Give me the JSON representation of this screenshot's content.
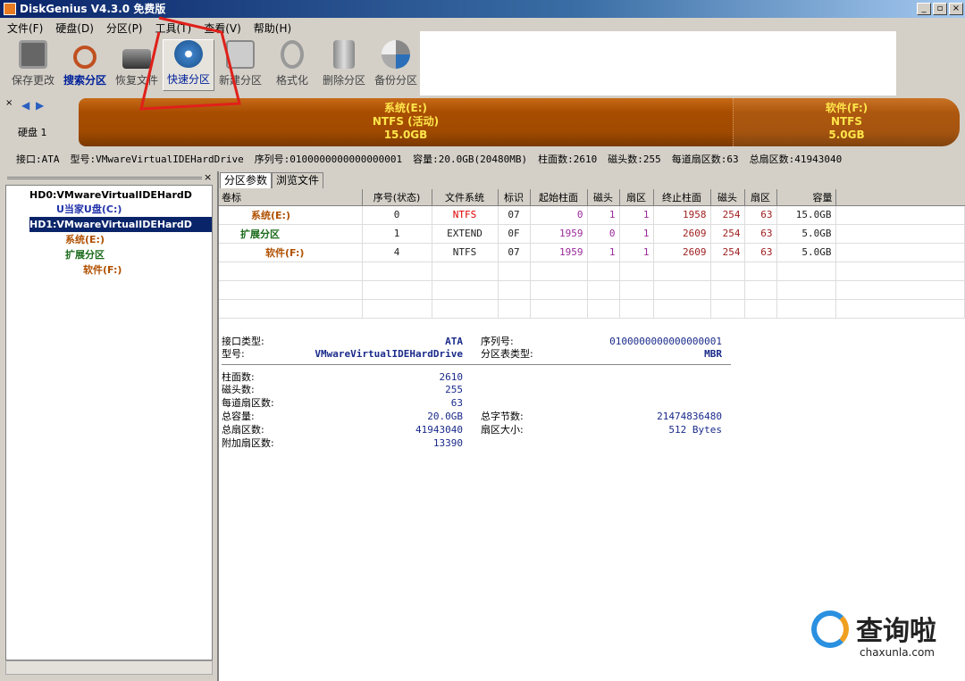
{
  "window": {
    "title": "DiskGenius V4.3.0 免费版",
    "controls": [
      "_",
      "▫",
      "×"
    ]
  },
  "menu": [
    "文件(F)",
    "硬盘(D)",
    "分区(P)",
    "工具(T)",
    "查看(V)",
    "帮助(H)"
  ],
  "toolbar": [
    {
      "label": "保存更改",
      "icon": "save-icon"
    },
    {
      "label": "搜索分区",
      "icon": "search-icon"
    },
    {
      "label": "恢复文件",
      "icon": "restore-icon"
    },
    {
      "label": "快速分区",
      "icon": "quick-partition-icon"
    },
    {
      "label": "新建分区",
      "icon": "new-partition-icon"
    },
    {
      "label": "格式化",
      "icon": "format-icon"
    },
    {
      "label": "删除分区",
      "icon": "delete-icon"
    },
    {
      "label": "备份分区",
      "icon": "backup-icon"
    }
  ],
  "diskbar": {
    "disk_label": "硬盘 1",
    "partitions": [
      {
        "name": "系统(E:)",
        "fs": "NTFS (活动)",
        "size": "15.0GB"
      },
      {
        "name": "软件(F:)",
        "fs": "NTFS",
        "size": "5.0GB"
      }
    ]
  },
  "diskinfo": [
    "接口:ATA",
    "型号:VMwareVirtualIDEHardDrive",
    "序列号:0100000000000000001",
    "容量:20.0GB(20480MB)",
    "柱面数:2610",
    "磁头数:255",
    "每道扇区数:63",
    "总扇区数:41943040"
  ],
  "tree": {
    "hd0": "HD0:VMwareVirtualIDEHardD",
    "hd0_c": "U当家U盘(C:)",
    "hd1": "HD1:VMwareVirtualIDEHardD",
    "hd1_e": "系统(E:)",
    "hd1_ext": "扩展分区",
    "hd1_f": "软件(F:)"
  },
  "tabs": [
    "分区参数",
    "浏览文件"
  ],
  "table": {
    "headers": [
      "卷标",
      "序号(状态)",
      "文件系统",
      "标识",
      "起始柱面",
      "磁头",
      "扇区",
      "终止柱面",
      "磁头",
      "扇区",
      "容量"
    ],
    "rows": [
      [
        "系统(E:)",
        "0",
        "NTFS",
        "07",
        "0",
        "1",
        "1",
        "1958",
        "254",
        "63",
        "15.0GB"
      ],
      [
        "扩展分区",
        "1",
        "EXTEND",
        "0F",
        "1959",
        "0",
        "1",
        "2609",
        "254",
        "63",
        "5.0GB"
      ],
      [
        "软件(F:)",
        "4",
        "NTFS",
        "07",
        "1959",
        "1",
        "1",
        "2609",
        "254",
        "63",
        "5.0GB"
      ]
    ]
  },
  "details": {
    "iface_label": "接口类型:",
    "iface": "ATA",
    "serial_label": "序列号:",
    "serial": "0100000000000000001",
    "model_label": "型号:",
    "model": "VMwareVirtualIDEHardDrive",
    "pt_label": "分区表类型:",
    "pt": "MBR",
    "cyl_label": "柱面数:",
    "cyl": "2610",
    "heads_label": "磁头数:",
    "heads": "255",
    "spt_label": "每道扇区数:",
    "spt": "63",
    "cap_label": "总容量:",
    "cap": "20.0GB",
    "bytes_label": "总字节数:",
    "bytes": "21474836480",
    "sectors_label": "总扇区数:",
    "sectors": "41943040",
    "ssize_label": "扇区大小:",
    "ssize": "512 Bytes",
    "extra_label": "附加扇区数:",
    "extra": "13390"
  },
  "watermark": {
    "brand": "查询啦",
    "url": "chaxunla.com"
  }
}
